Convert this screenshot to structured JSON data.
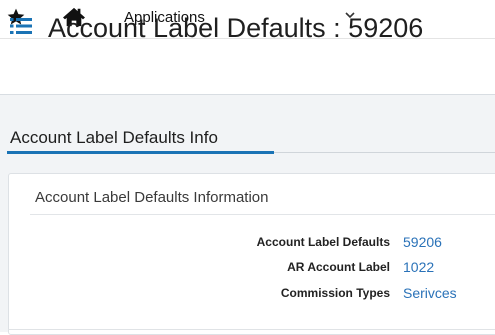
{
  "topnav": {
    "favorites_icon": "star-icon",
    "home_icon": "home-icon",
    "apps_label": "Applications",
    "apps_dropdown_icon": "chevron-down-icon"
  },
  "header": {
    "menu_icon": "list-menu-icon",
    "title": "Account Label Defaults : 59206"
  },
  "section": {
    "tab_label": "Account Label Defaults Info",
    "accent_color": "#1a73b5"
  },
  "card": {
    "title": "Account Label Defaults Information",
    "fields": [
      {
        "label": "Account Label Defaults",
        "value": "59206"
      },
      {
        "label": "AR Account Label",
        "value": "1022"
      },
      {
        "label": "Commission Types",
        "value": "Serivces"
      }
    ],
    "link_color": "#2a72b8"
  }
}
